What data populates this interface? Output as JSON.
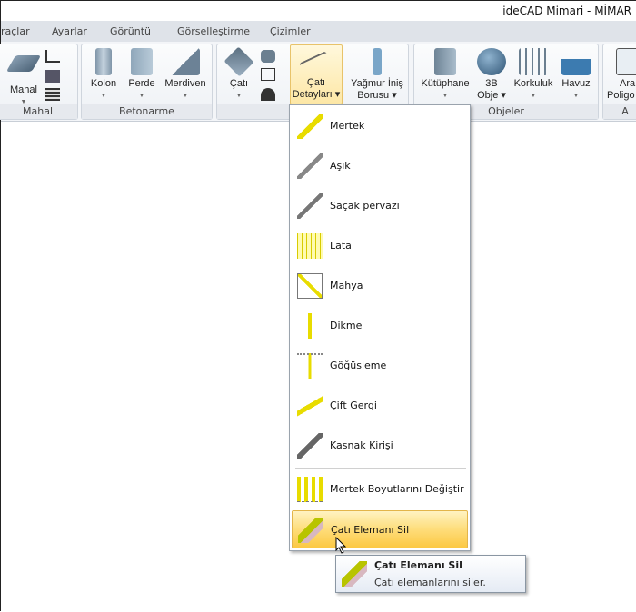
{
  "window": {
    "title": "ideCAD Mimari - MİMAR"
  },
  "tabs": [
    "raçlar",
    "Ayarlar",
    "Görüntü",
    "Görselleştirme",
    "Çizimler"
  ],
  "ribbon": {
    "groups": [
      "Mahal",
      "Betonarme",
      "",
      "Objeler",
      "A"
    ],
    "buttons": {
      "mahal": "Mahal",
      "kolon": "Kolon",
      "perde": "Perde",
      "merdiven": "Merdiven",
      "cati": "Çatı",
      "cati_detay_1": "Çatı",
      "cati_detay_2": "Detayları",
      "yagmur_1": "Yağmur İniş",
      "yagmur_2": "Borusu",
      "kutuphane": "Kütüphane",
      "obje_1": "3B",
      "obje_2": "Obje",
      "korkuluk": "Korkuluk",
      "havuz": "Havuz",
      "ara_1": "Ara",
      "ara_2": "Poligo"
    }
  },
  "menu": {
    "items": [
      "Mertek",
      "Aşık",
      "Saçak pervazı",
      "Lata",
      "Mahya",
      "Dikme",
      "Göğüsleme",
      "Çift Gergi",
      "Kasnak Kirişi",
      "Mertek Boyutlarını Değiştir",
      "Çatı Elemanı Sil"
    ],
    "highlighted": "Çatı Elemanı Sil"
  },
  "tooltip": {
    "title": "Çatı Elemanı Sil",
    "description": "Çatı elemanlarını siler."
  },
  "colors": {
    "highlight": "#fedd7a",
    "icon_yellow": "#f2e600"
  }
}
